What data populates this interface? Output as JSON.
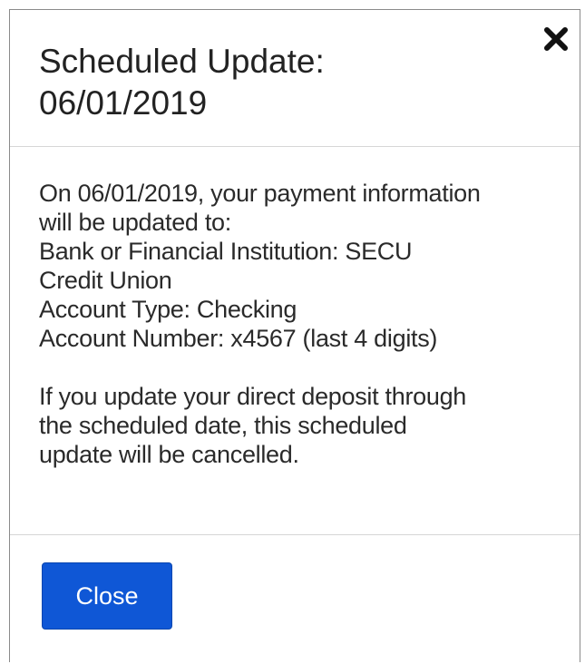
{
  "dialog": {
    "title_line1": "Scheduled Update:",
    "title_line2": "06/01/2019",
    "close_icon": "close-x-icon",
    "body": {
      "line1": "On 06/01/2019, your payment information",
      "line2": "will be updated to:",
      "line3": "Bank or Financial Institution: SECU",
      "line4": "Credit Union",
      "line5": "Account Type: Checking",
      "line6": "Account Number: x4567 (last 4 digits)",
      "line7": "If you update your direct deposit through",
      "line8": "the scheduled date, this scheduled",
      "line9": "update will be cancelled."
    },
    "close_button_label": "Close"
  },
  "colors": {
    "primary_button": "#0f57d6",
    "border": "#8a8a8a",
    "divider": "#d6d6d6",
    "text": "#222222"
  }
}
